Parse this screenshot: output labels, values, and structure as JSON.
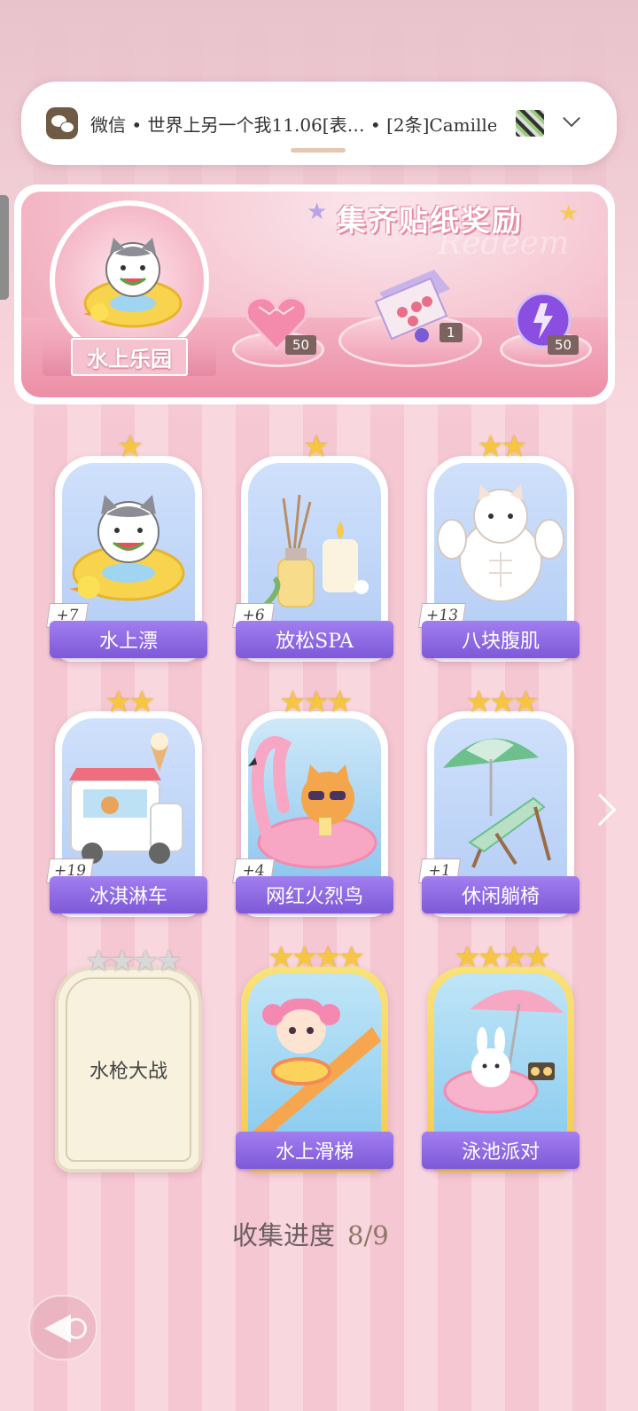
{
  "notification": {
    "text": "微信 • 世界上另一个我11.06[表… • [2条]Camille:…",
    "app_icon": "wechat-icon"
  },
  "banner": {
    "title": "集齐贴纸奖励",
    "badge_label": "水上乐园",
    "rewards": [
      {
        "name": "pink-heart-gem",
        "count": "50"
      },
      {
        "name": "gift-box",
        "count": "1"
      },
      {
        "name": "purple-energy-orb",
        "count": "50"
      }
    ]
  },
  "stickers": [
    {
      "name": "水上漂",
      "stars": 1,
      "max_stars": 1,
      "count": "+7",
      "collected": true
    },
    {
      "name": "放松SPA",
      "stars": 1,
      "max_stars": 1,
      "count": "+6",
      "collected": true
    },
    {
      "name": "八块腹肌",
      "stars": 2,
      "max_stars": 2,
      "count": "+13",
      "collected": true
    },
    {
      "name": "冰淇淋车",
      "stars": 2,
      "max_stars": 2,
      "count": "+19",
      "collected": true
    },
    {
      "name": "网红火烈鸟",
      "stars": 3,
      "max_stars": 3,
      "count": "+4",
      "collected": true
    },
    {
      "name": "休闲躺椅",
      "stars": 3,
      "max_stars": 3,
      "count": "+1",
      "collected": true
    },
    {
      "name": "水枪大战",
      "stars": 0,
      "max_stars": 4,
      "count": "",
      "collected": false
    },
    {
      "name": "水上滑梯",
      "stars": 4,
      "max_stars": 4,
      "count": "",
      "collected": true
    },
    {
      "name": "泳池派对",
      "stars": 4,
      "max_stars": 4,
      "count": "",
      "collected": true
    }
  ],
  "progress": {
    "label": "收集进度",
    "value": "8/9"
  },
  "colors": {
    "label_purple": "#8b66e0",
    "star_gold": "#f7c544",
    "background_pink": "#f9d7df"
  }
}
